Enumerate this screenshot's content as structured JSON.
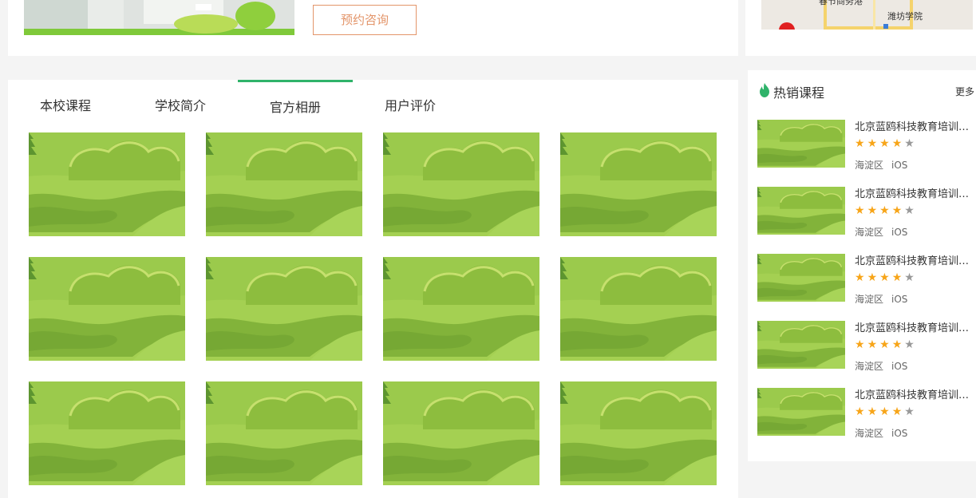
{
  "top": {
    "consult_button": "预约咨询"
  },
  "map": {
    "labels": [
      "春节商务港",
      "潍坊学院"
    ],
    "colors": {
      "road": "#f5d36c",
      "marker": "#e02020",
      "bg": "#ede9e3"
    }
  },
  "tabs": [
    {
      "label": "本校课程",
      "active": false
    },
    {
      "label": "学校简介",
      "active": false
    },
    {
      "label": "官方相册",
      "active": true
    },
    {
      "label": "用户评价",
      "active": false
    }
  ],
  "gallery": {
    "rows": 3,
    "columns": 4,
    "item_icon": "landscape-image"
  },
  "hot_courses": {
    "title": "热销课程",
    "more": "更多",
    "icon": "flame-icon",
    "accent": "#2fb36a",
    "items": [
      {
        "title": "北京蓝鸥科技教育培训学校",
        "rating": 4,
        "max_rating": 5,
        "district": "海淀区",
        "tag": "iOS"
      },
      {
        "title": "北京蓝鸥科技教育培训学校",
        "rating": 4,
        "max_rating": 5,
        "district": "海淀区",
        "tag": "iOS"
      },
      {
        "title": "北京蓝鸥科技教育培训学校",
        "rating": 4,
        "max_rating": 5,
        "district": "海淀区",
        "tag": "iOS"
      },
      {
        "title": "北京蓝鸥科技教育培训学校",
        "rating": 4,
        "max_rating": 5,
        "district": "海淀区",
        "tag": "iOS"
      },
      {
        "title": "北京蓝鸥科技教育培训学校",
        "rating": 4,
        "max_rating": 5,
        "district": "海淀区",
        "tag": "iOS"
      }
    ]
  },
  "colors": {
    "page_bg": "#f4f4f4",
    "tab_active": "#2fb36a",
    "button_border": "#e3956a",
    "star_on": "#f7a519",
    "star_off": "#999999"
  }
}
